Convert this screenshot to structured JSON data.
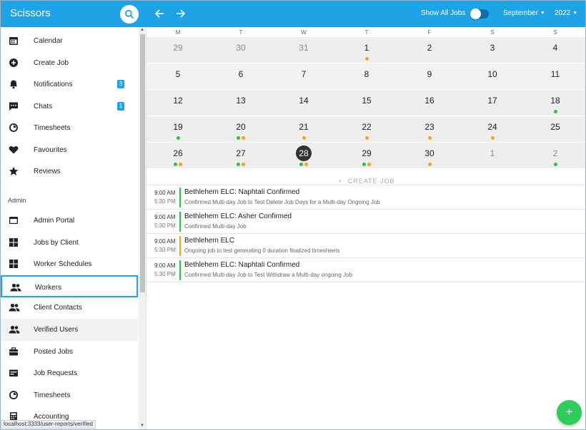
{
  "header": {
    "app_title": "Scissors",
    "show_all_jobs_label": "Show All Jobs",
    "show_all_jobs_on": true,
    "month": "September",
    "year": "2022"
  },
  "sidebar": {
    "items": [
      {
        "label": "Calendar",
        "icon": "calendar-icon"
      },
      {
        "label": "Create Job",
        "icon": "plus-circle-icon"
      },
      {
        "label": "Notifications",
        "icon": "bell-icon",
        "badge": "3"
      },
      {
        "label": "Chats",
        "icon": "chat-icon",
        "badge": "1"
      },
      {
        "label": "Timesheets",
        "icon": "timer-icon"
      },
      {
        "label": "Favourites",
        "icon": "heart-icon"
      },
      {
        "label": "Reviews",
        "icon": "star-icon"
      }
    ],
    "section_label": "Admin",
    "admin_items": [
      {
        "label": "Admin Portal",
        "icon": "window-icon"
      },
      {
        "label": "Jobs by Client",
        "icon": "grid-icon"
      },
      {
        "label": "Worker Schedules",
        "icon": "grid-icon"
      },
      {
        "label": "Workers",
        "icon": "people-icon",
        "state": "focused"
      },
      {
        "label": "Client Contacts",
        "icon": "people-icon"
      },
      {
        "label": "Verified Users",
        "icon": "people-icon",
        "state": "hover"
      },
      {
        "label": "Posted Jobs",
        "icon": "briefcase-icon"
      },
      {
        "label": "Job Requests",
        "icon": "card-icon"
      },
      {
        "label": "Timesheets",
        "icon": "timer-icon"
      },
      {
        "label": "Accounting",
        "icon": "calculator-icon"
      }
    ]
  },
  "status_url": "localhost:3333/user-reports/verified",
  "calendar": {
    "weekdays": [
      "M",
      "T",
      "W",
      "T",
      "F",
      "S",
      "S"
    ],
    "weeks": [
      [
        {
          "d": "29",
          "m": true
        },
        {
          "d": "30",
          "m": true
        },
        {
          "d": "31",
          "m": true
        },
        {
          "d": "1",
          "dots": [
            "orange"
          ]
        },
        {
          "d": "2"
        },
        {
          "d": "3"
        },
        {
          "d": "4"
        }
      ],
      [
        {
          "d": "5"
        },
        {
          "d": "6"
        },
        {
          "d": "7"
        },
        {
          "d": "8"
        },
        {
          "d": "9"
        },
        {
          "d": "10"
        },
        {
          "d": "11"
        }
      ],
      [
        {
          "d": "12"
        },
        {
          "d": "13"
        },
        {
          "d": "14"
        },
        {
          "d": "15"
        },
        {
          "d": "16"
        },
        {
          "d": "17"
        },
        {
          "d": "18",
          "dots": [
            "green"
          ]
        }
      ],
      [
        {
          "d": "19",
          "dots": [
            "green"
          ]
        },
        {
          "d": "20",
          "dots": [
            "green",
            "orange"
          ]
        },
        {
          "d": "21",
          "dots": [
            "orange"
          ]
        },
        {
          "d": "22",
          "dots": [
            "orange"
          ]
        },
        {
          "d": "23",
          "dots": [
            "orange"
          ]
        },
        {
          "d": "24",
          "dots": [
            "orange"
          ]
        },
        {
          "d": "25"
        }
      ],
      [
        {
          "d": "26",
          "dots": [
            "green",
            "orange"
          ]
        },
        {
          "d": "27",
          "dots": [
            "green",
            "orange"
          ]
        },
        {
          "d": "28",
          "today": true,
          "dots": [
            "green",
            "orange"
          ]
        },
        {
          "d": "29",
          "dots": [
            "green",
            "orange"
          ]
        },
        {
          "d": "30",
          "dots": [
            "orange"
          ]
        },
        {
          "d": "1",
          "m": true
        },
        {
          "d": "2",
          "m": true,
          "dots": [
            "green"
          ]
        }
      ]
    ],
    "create_job_label": "CREATE JOB"
  },
  "jobs": [
    {
      "start": "9:00 AM",
      "end": "5:30 PM",
      "title": "Bethlehem ELC: Naphtali Confirmed",
      "desc": "Confirmed Multi-day Job to Test Delete Job Days for a Multi-day Ongoing Job",
      "color": "#27c33e"
    },
    {
      "start": "9:00 AM",
      "end": "5:30 PM",
      "title": "Bethlehem ELC: Asher Confirmed",
      "desc": "Confirmed Multi-day Job",
      "color": "#27c33e"
    },
    {
      "start": "9:00 AM",
      "end": "5:30 PM",
      "title": "Bethlehem ELC",
      "desc": "Ongoing job to test generating 0 duration finalized timesheets",
      "color": "#f6a31d"
    },
    {
      "start": "9:00 AM",
      "end": "5:30 PM",
      "title": "Bethlehem ELC: Naphtali Confirmed",
      "desc": "Confirmed Multi-day Job to Test Withdraw a Multi-day ongoing Job",
      "color": "#27c33e"
    }
  ],
  "colors": {
    "accent": "#1ea4e6",
    "green": "#27c33e",
    "orange": "#f6a31d",
    "fab": "#2ecc5a"
  }
}
